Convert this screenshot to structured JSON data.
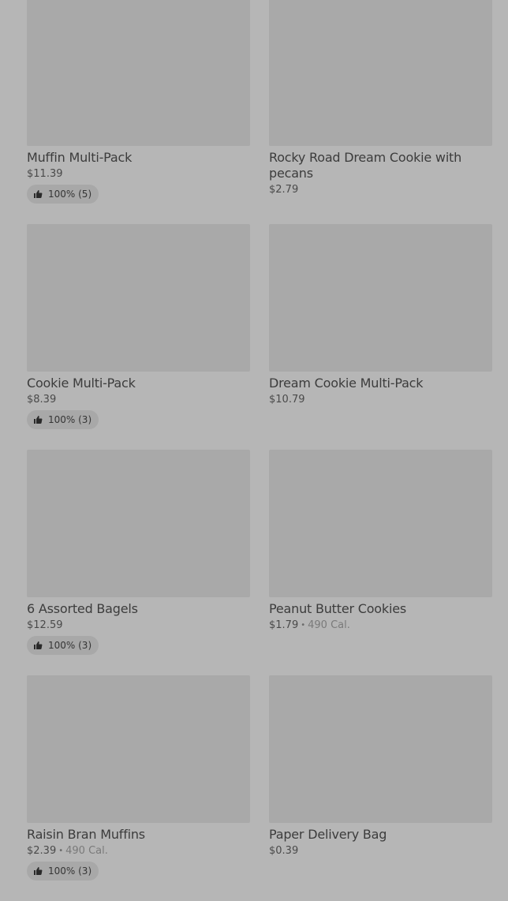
{
  "products": [
    {
      "name": "Muffin Multi-Pack",
      "price": "$11.39",
      "calories": "",
      "rating": "100% (5)"
    },
    {
      "name": "Rocky Road Dream Cookie with pecans",
      "price": "$2.79",
      "calories": "",
      "rating": ""
    },
    {
      "name": "Cookie Multi-Pack",
      "price": "$8.39",
      "calories": "",
      "rating": "100% (3)"
    },
    {
      "name": "Dream Cookie Multi-Pack",
      "price": "$10.79",
      "calories": "",
      "rating": ""
    },
    {
      "name": "6 Assorted Bagels",
      "price": "$12.59",
      "calories": "",
      "rating": "100% (3)"
    },
    {
      "name": "Peanut Butter Cookies",
      "price": "$1.79",
      "calories": "490 Cal.",
      "rating": ""
    },
    {
      "name": "Raisin Bran Muffins",
      "price": "$2.39",
      "calories": "490 Cal.",
      "rating": "100% (3)"
    },
    {
      "name": "Paper Delivery Bag",
      "price": "$0.39",
      "calories": "",
      "rating": ""
    }
  ],
  "icons": {
    "rating": "thumbs-up-icon"
  },
  "colors": {
    "overlay": "#b6b6b6",
    "image_placeholder": "#a9a9a9"
  }
}
